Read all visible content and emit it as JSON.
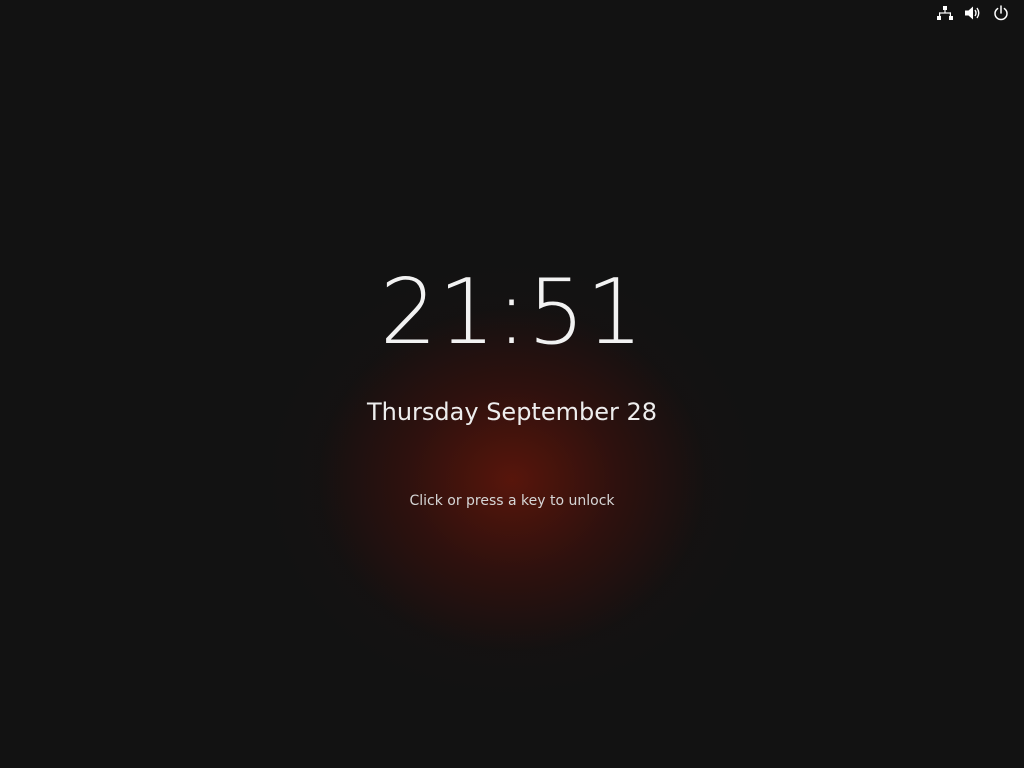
{
  "topbar": {
    "icons": [
      "network-icon",
      "volume-icon",
      "power-icon"
    ]
  },
  "lockscreen": {
    "time": "21:51",
    "date": "Thursday September 28",
    "hint": "Click or press a key to unlock"
  },
  "colors": {
    "background": "#121212",
    "glow": "#641608",
    "text": "#ffffff"
  }
}
